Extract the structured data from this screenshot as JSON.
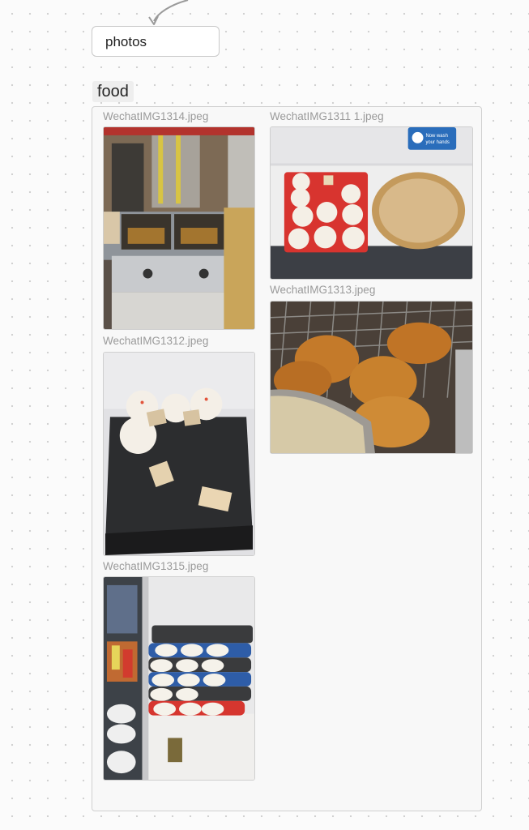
{
  "photos_card": {
    "label": "photos"
  },
  "group": {
    "title": "food",
    "images": [
      {
        "filename": "WechatIMG1314.jpeg",
        "subject": "fryer stall on street"
      },
      {
        "filename": "WechatIMG1311 1.jpeg",
        "subject": "steamed buns on red tray",
        "sign_text": "Now wash your hands"
      },
      {
        "filename": "WechatIMG1312.jpeg",
        "subject": "buns on black tray"
      },
      {
        "filename": "WechatIMG1313.jpeg",
        "subject": "fried fritters on rack"
      },
      {
        "filename": "WechatIMG1315.jpeg",
        "subject": "stacked bun trays"
      }
    ]
  },
  "colors": {
    "card_border": "#c9c9c9",
    "label_gray": "#9a9a9a",
    "group_bg": "#f8f8f8"
  }
}
